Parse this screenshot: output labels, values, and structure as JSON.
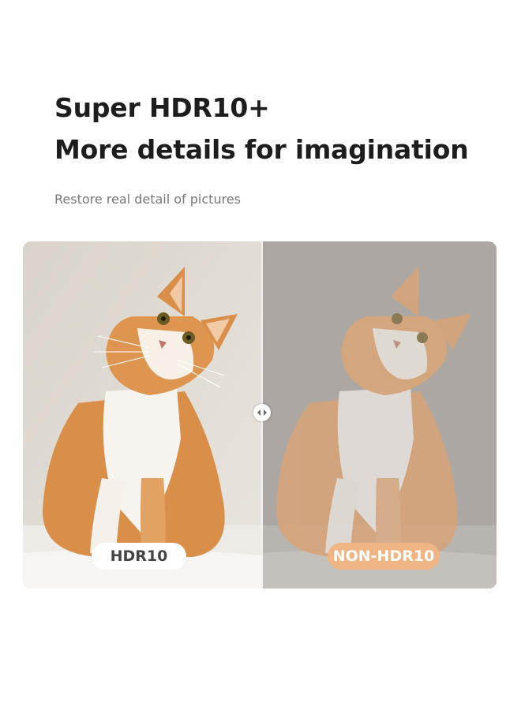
{
  "header": {
    "title_line1": "Super HDR10+",
    "title_line2": "More details for imagination",
    "subtitle": "Restore real detail of pictures"
  },
  "comparison": {
    "left": {
      "badge_label": "HDR10",
      "image_icon": "cat-photo-icon"
    },
    "right": {
      "badge_label": "NON-HDR10",
      "image_icon": "cat-photo-icon"
    },
    "handle_icon": "left-right-arrows-icon"
  },
  "colors": {
    "title": "#1d1d1d",
    "subtitle": "#777777",
    "badge_hdr_bg": "#ffffff",
    "badge_hdr_text": "#454545",
    "badge_non_bg": "#f0b585",
    "badge_non_text": "#ffffff",
    "cat_orange": "#d98f4a",
    "cat_white": "#f7f3ee"
  }
}
